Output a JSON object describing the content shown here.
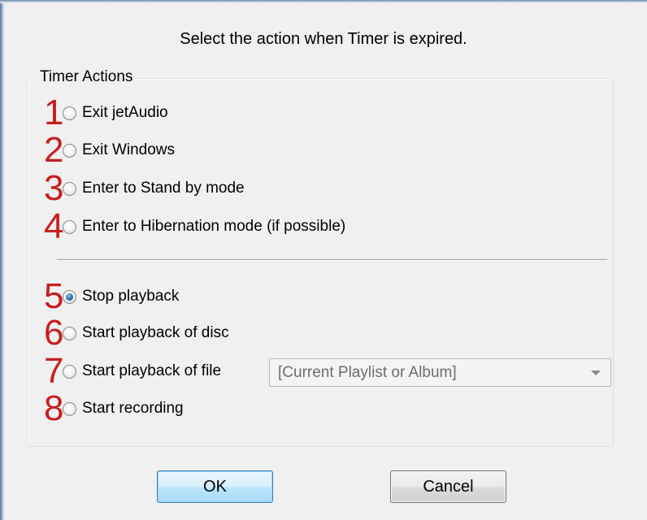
{
  "prompt": "Select the action when Timer is expired.",
  "group_title": "Timer Actions",
  "options": [
    {
      "number": "1",
      "label": "Exit jetAudio",
      "checked": false
    },
    {
      "number": "2",
      "label": "Exit Windows",
      "checked": false
    },
    {
      "number": "3",
      "label": "Enter to Stand by mode",
      "checked": false
    },
    {
      "number": "4",
      "label": "Enter to Hibernation mode (if possible)",
      "checked": false
    },
    {
      "number": "5",
      "label": "Stop playback",
      "checked": true
    },
    {
      "number": "6",
      "label": "Start playback of disc",
      "checked": false
    },
    {
      "number": "7",
      "label": "Start playback of file",
      "checked": false
    },
    {
      "number": "8",
      "label": "Start recording",
      "checked": false
    }
  ],
  "file_select": {
    "value": "[Current Playlist or Album]",
    "enabled": false
  },
  "buttons": {
    "ok": "OK",
    "cancel": "Cancel"
  },
  "colors": {
    "annotation_numbers": "#c81e1e",
    "ok_border": "#3c7fb1"
  }
}
